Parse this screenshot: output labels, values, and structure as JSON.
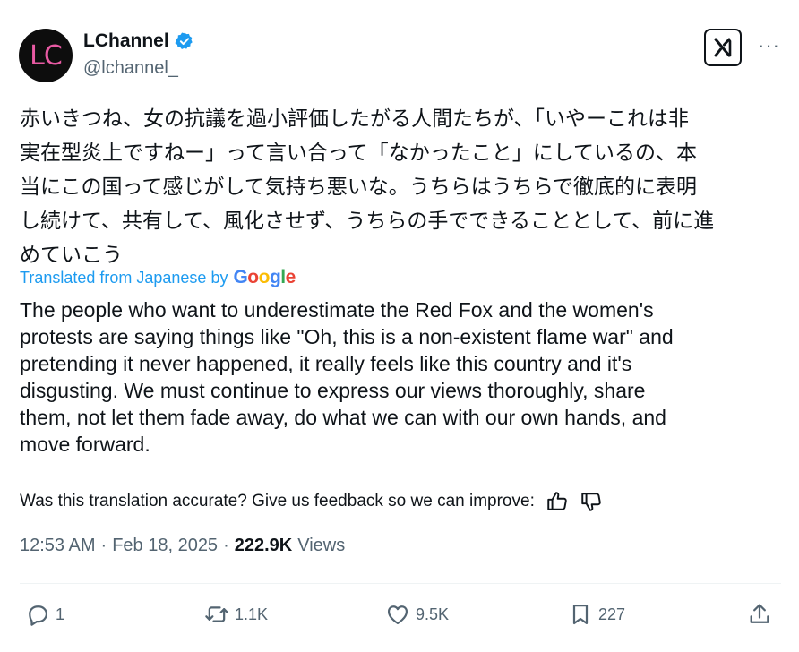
{
  "author": {
    "avatar_text": "LC",
    "display_name": "LChannel",
    "handle": "@lchannel_",
    "verified_color": "#1d9bf0",
    "avatar_text_color": "#e85aa3"
  },
  "header": {
    "grok_icon": "grok-x-icon",
    "more_label": "···"
  },
  "post": {
    "original_text": "赤いきつね、女の抗議を過小評価したがる人間たちが、「いやーこれは非\n実在型炎上ですねー」って言い合って「なかったこと」にしているの、本\n当にこの国って感じがして気持ち悪いな。うちらはうちらで徹底的に表明\nし続けて、共有して、風化させず、うちらの手でできることとして、前に進\nめていこう",
    "translation_label": "Translated from Japanese by",
    "google_logo": [
      "G",
      "o",
      "o",
      "g",
      "l",
      "e"
    ],
    "google_colors": [
      "#4285f4",
      "#ea4335",
      "#fbbc05",
      "#4285f4",
      "#34a853",
      "#ea4335"
    ],
    "translated_text": "The people who want to underestimate the Red Fox and the women's\nprotests are saying things like \"Oh, this is a non-existent flame war\" and\npretending it never happened, it really feels like this country and it's\ndisgusting. We must continue to express our views thoroughly, share\nthem, not let them fade away, do what we can with our own hands, and\nmove forward.",
    "feedback_question": "Was this translation accurate? Give us feedback so we can improve:"
  },
  "meta": {
    "time": "12:53 AM",
    "sep1": "·",
    "date": "Feb 18, 2025",
    "sep2": "·",
    "views_count": "222.9K",
    "views_label": "Views"
  },
  "actions": {
    "replies": "1",
    "reposts": "1.1K",
    "likes": "9.5K",
    "bookmarks": "227"
  },
  "colors": {
    "accent": "#1d9bf0",
    "secondary_text": "#536471",
    "primary_text": "#0f1419"
  }
}
